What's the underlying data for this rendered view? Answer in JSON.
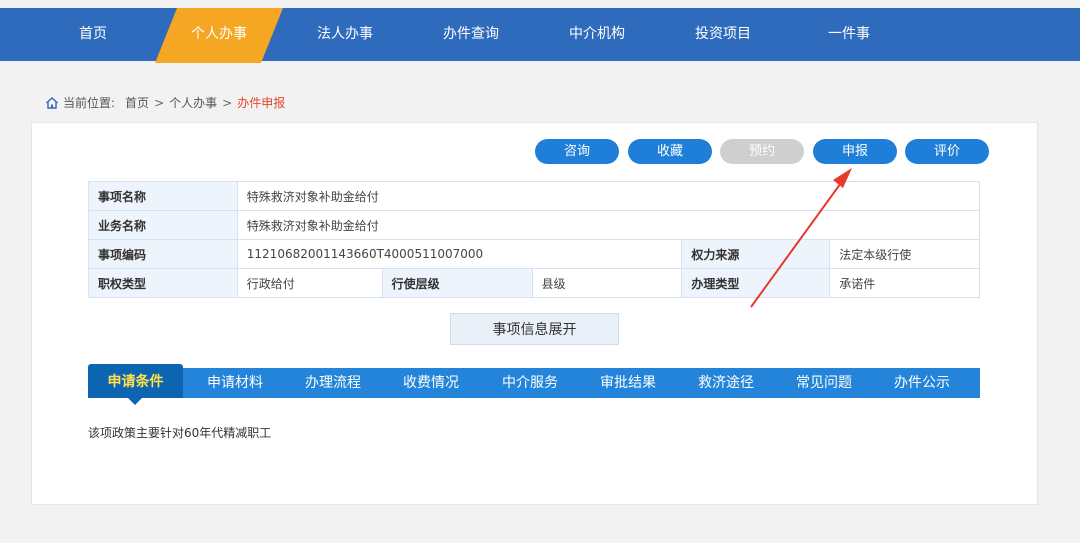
{
  "nav": {
    "items": [
      {
        "label": "首页"
      },
      {
        "label": "个人办事"
      },
      {
        "label": "法人办事"
      },
      {
        "label": "办件查询"
      },
      {
        "label": "中介机构"
      },
      {
        "label": "投资项目"
      },
      {
        "label": "一件事"
      }
    ],
    "active_index": 1,
    "colors": {
      "bar": "#2f6bbd",
      "active": "#f5a623"
    }
  },
  "breadcrumb": {
    "prefix": "当前位置:",
    "items": [
      "首页",
      "个人办事",
      "办件申报"
    ],
    "separator": ">"
  },
  "actions": {
    "consult": "咨询",
    "favorite": "收藏",
    "reserve": "预约",
    "apply": "申报",
    "evaluate": "评价"
  },
  "info": {
    "rows": [
      {
        "k1": "事项名称",
        "v1": "特殊救济对象补助金给付"
      },
      {
        "k1": "业务名称",
        "v1": "特殊救济对象补助金给付"
      },
      {
        "k1": "事项编码",
        "v1": "11210682001143660T4000511007000",
        "k2": "权力来源",
        "v2": "法定本级行使"
      },
      {
        "k1": "职权类型",
        "v1": "行政给付",
        "k2": "行使层级",
        "v2": "县级",
        "k3": "办理类型",
        "v3": "承诺件"
      }
    ]
  },
  "expand_label": "事项信息展开",
  "tabs": {
    "items": [
      "申请条件",
      "申请材料",
      "办理流程",
      "收费情况",
      "中介服务",
      "审批结果",
      "救济途径",
      "常见问题",
      "办件公示"
    ],
    "active_index": 0
  },
  "content": {
    "text": "该项政策主要针对60年代精减职工"
  },
  "annotation": {
    "arrow_color": "#e8392b"
  }
}
